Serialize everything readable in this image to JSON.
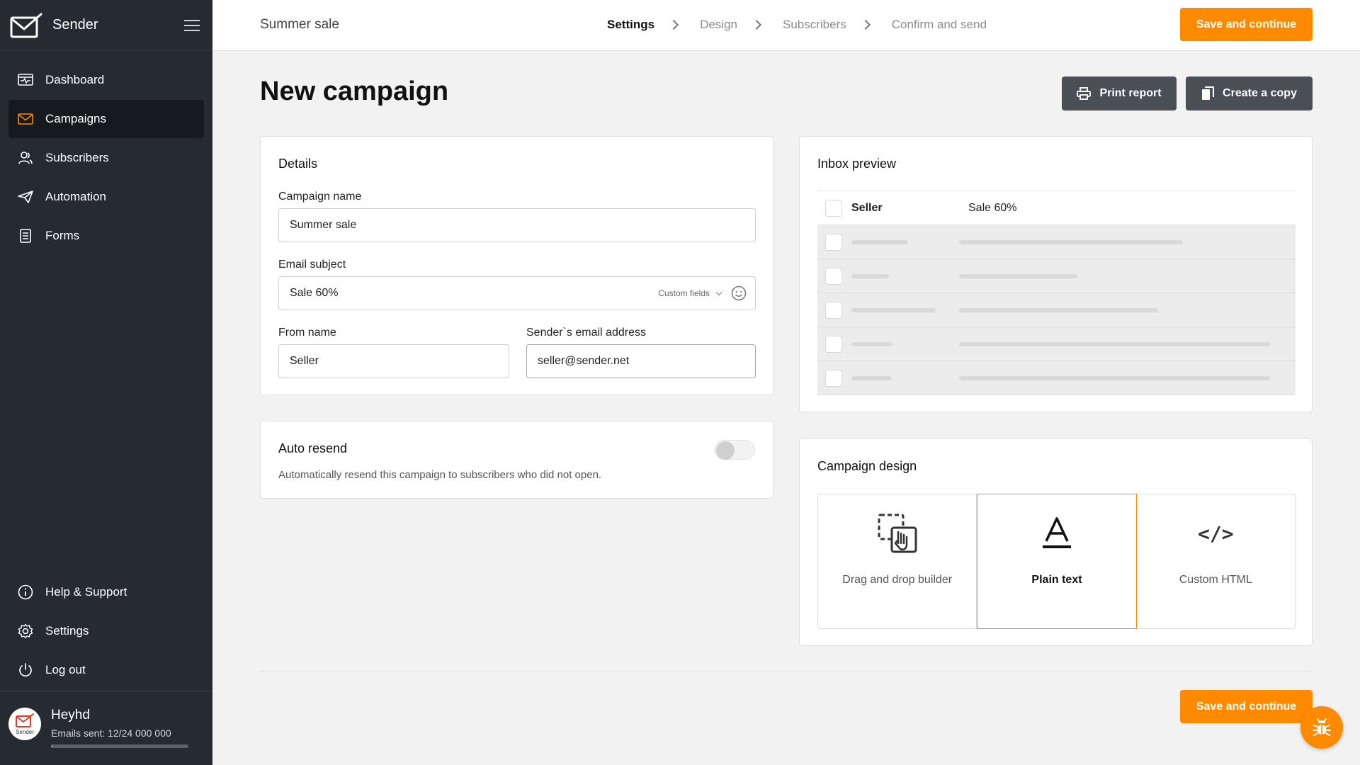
{
  "app": {
    "name": "Sender"
  },
  "sidebar": {
    "items": [
      {
        "label": "Dashboard",
        "icon": "dashboard-icon"
      },
      {
        "label": "Campaigns",
        "icon": "envelope-icon",
        "active": true
      },
      {
        "label": "Subscribers",
        "icon": "users-icon"
      },
      {
        "label": "Automation",
        "icon": "paper-plane-icon"
      },
      {
        "label": "Forms",
        "icon": "form-icon"
      }
    ],
    "bottom_items": [
      {
        "label": "Help & Support",
        "icon": "info-icon"
      },
      {
        "label": "Settings",
        "icon": "gear-icon"
      },
      {
        "label": "Log out",
        "icon": "power-icon"
      }
    ],
    "user": {
      "name": "Heyhd",
      "emails_sent": "Emails sent: 12/24 000 000",
      "avatar_text": "Sender",
      "usage_fraction": 0.0005
    }
  },
  "topbar": {
    "campaign_name": "Summer sale",
    "steps": [
      "Settings",
      "Design",
      "Subscribers",
      "Confirm and send"
    ],
    "active_step": "Settings",
    "save_label": "Save and continue"
  },
  "main": {
    "title": "New campaign",
    "print_label": "Print report",
    "copy_label": "Create a copy"
  },
  "details": {
    "title": "Details",
    "campaign_name_label": "Campaign name",
    "campaign_name_value": "Summer sale",
    "email_subject_label": "Email subject",
    "email_subject_value": "Sale 60%",
    "custom_fields_label": "Custom fields",
    "from_name_label": "From name",
    "from_name_value": "Seller",
    "sender_email_label": "Sender`s email address",
    "sender_email_value": "seller@sender.net"
  },
  "auto_resend": {
    "title": "Auto resend",
    "description": "Automatically resend this campaign to subscribers who did not open.",
    "enabled": false
  },
  "inbox_preview": {
    "title": "Inbox preview",
    "from": "Seller",
    "subject": "Sale 60%"
  },
  "campaign_design": {
    "title": "Campaign design",
    "options": [
      "Drag and drop builder",
      "Plain text",
      "Custom HTML"
    ],
    "selected": "Plain text",
    "html_glyph": "</>"
  },
  "colors": {
    "accent": "#ff8a00",
    "sidebar": "#262a31",
    "dark_button": "#4a4f56"
  }
}
